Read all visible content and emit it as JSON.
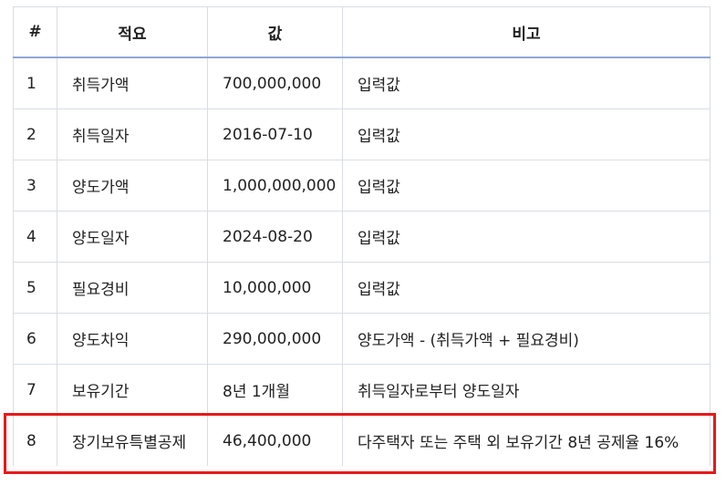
{
  "table": {
    "headers": [
      "#",
      "적요",
      "값",
      "비고"
    ],
    "rows": [
      {
        "num": "1",
        "item": "취득가액",
        "value": "700,000,000",
        "note": "입력값"
      },
      {
        "num": "2",
        "item": "취득일자",
        "value": "2016-07-10",
        "note": "입력값"
      },
      {
        "num": "3",
        "item": "양도가액",
        "value": "1,000,000,000",
        "note": "입력값"
      },
      {
        "num": "4",
        "item": "양도일자",
        "value": "2024-08-20",
        "note": "입력값"
      },
      {
        "num": "5",
        "item": "필요경비",
        "value": "10,000,000",
        "note": "입력값"
      },
      {
        "num": "6",
        "item": "양도차익",
        "value": "290,000,000",
        "note": "양도가액 - (취득가액 + 필요경비)"
      },
      {
        "num": "7",
        "item": "보유기간",
        "value": "8년 1개월",
        "note": "취득일자로부터 양도일자"
      },
      {
        "num": "8",
        "item": "장기보유특별공제",
        "value": "46,400,000",
        "note": "다주택자 또는 주택 외 보유기간 8년 공제율 16%"
      }
    ]
  },
  "highlight": {
    "row_number": "8",
    "color": "#e8191a"
  }
}
